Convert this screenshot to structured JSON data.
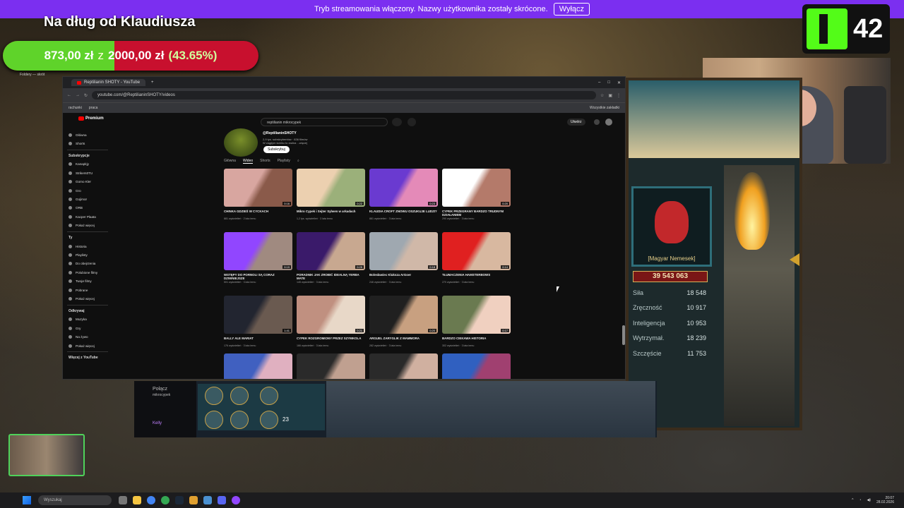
{
  "banner": {
    "text": "Tryb streamowania włączony. Nazwy użytkownika zostały skrócone.",
    "button": "Wyłącz"
  },
  "goal": {
    "title": "Na dług od Klaudiusza",
    "current": "873,00 zł",
    "sep": "z",
    "target": "2000,00 zł",
    "percent_text": "(43.65%)",
    "fraction": 0.4365,
    "fill_color": "#5fd32a",
    "bar_color": "#c8102e"
  },
  "kick": {
    "count": "42",
    "brand_color": "#53fc18"
  },
  "folder_label": "Foldery — skrót",
  "browser": {
    "tab_title": "Reptilianin SHOTY - YouTube",
    "url": "youtube.com/@ReptilianinSHOTY/videos",
    "bookmarks": [
      "rachunki",
      "praca"
    ],
    "bookmarks_right": "Wszystkie zakładki"
  },
  "youtube": {
    "logo": "Premium",
    "search_value": "reptilianin mikrocypek",
    "create": "Utwórz",
    "channel_name": "@ReptilianinSHOTY",
    "channel_meta": "2,9 tys. subskrybentów · 836 filmów",
    "channel_desc": "W ciągłym ścieku to żadna ...więcej",
    "subscribe": "Subskrybuj",
    "tabs": [
      "Główna",
      "Wideo",
      "Shorts",
      "Playlisty"
    ],
    "sidebar": [
      {
        "type": "item",
        "label": "Główna"
      },
      {
        "type": "item",
        "label": "Shorts"
      },
      {
        "type": "sep"
      },
      {
        "type": "head",
        "label": "Subskrypcje"
      },
      {
        "type": "item",
        "label": "Kanapkjy"
      },
      {
        "type": "item",
        "label": "Strikers0TU"
      },
      {
        "type": "item",
        "label": "Gomo Kler"
      },
      {
        "type": "item",
        "label": "Gro"
      },
      {
        "type": "item",
        "label": "Gojimor"
      },
      {
        "type": "item",
        "label": "ORB"
      },
      {
        "type": "item",
        "label": "Kacper Plaata"
      },
      {
        "type": "item",
        "label": "Pokaż więcej"
      },
      {
        "type": "sep"
      },
      {
        "type": "head",
        "label": "Ty"
      },
      {
        "type": "item",
        "label": "Historia"
      },
      {
        "type": "item",
        "label": "Playlisty"
      },
      {
        "type": "item",
        "label": "Do obejrzenia"
      },
      {
        "type": "item",
        "label": "Polubione filmy"
      },
      {
        "type": "item",
        "label": "Twoje filmy"
      },
      {
        "type": "item",
        "label": "Pobrane"
      },
      {
        "type": "item",
        "label": "Pokaż więcej"
      },
      {
        "type": "sep"
      },
      {
        "type": "head",
        "label": "Odkrywaj"
      },
      {
        "type": "item",
        "label": "Muzyka"
      },
      {
        "type": "item",
        "label": "Gry"
      },
      {
        "type": "item",
        "label": "Na żywo"
      },
      {
        "type": "item",
        "label": "Pokaż więcej"
      },
      {
        "type": "sep"
      },
      {
        "type": "head",
        "label": "Więcej z YouTube"
      }
    ],
    "videos": [
      {
        "title": "CHINKA GDZIEŚ W CYCKACH",
        "meta": "881 wyświetleń · 2 lata temu",
        "dur": "0:16",
        "c1": "#d8a6a0",
        "c2": "#8a5a4a"
      },
      {
        "title": "Mikro Cypek i Sejter Sylwen w arkadach",
        "meta": "1,2 tys. wyświetleń · 3 lata temu",
        "dur": "0:22",
        "c1": "#ecd0b0",
        "c2": "#9bb07a"
      },
      {
        "title": "KLAUDIA CROFT ZNOWU OSZUKUJE LUDZI?",
        "meta": "881 wyświetleń · 3 lata temu",
        "dur": "0:23",
        "c1": "#6a3ad0",
        "c2": "#e48ab8"
      },
      {
        "title": "CYPEK PRZEGRANY BARDZO TRUDNYM DZIAŁANIEM",
        "meta": "290 wyświetleń · 3 lata temu",
        "dur": "0:20",
        "c1": "#ffffff",
        "c2": "#b47a6a"
      },
      {
        "title": "WSTĘPY DO PORNOLI SĄ CORAZ DZIWNIEJSZE",
        "meta": "501 wyświetleń · 3 lata temu",
        "dur": "0:19",
        "c1": "#9146ff",
        "c2": "#a08a80"
      },
      {
        "title": "PORADNIK JAK ZROBIĆ IDEALNĄ YERBA MATE",
        "meta": "145 wyświetleń · 3 lata temu",
        "dur": "0:25",
        "c1": "#3a1a6a",
        "c2": "#c8a890"
      },
      {
        "title": "Bolesławiec Kluksza ArGoer",
        "meta": "246 wyświetleń · 3 lata temu",
        "dur": "0:18",
        "c1": "#9fa8b0",
        "c2": "#d0b8a8"
      },
      {
        "title": "TŁUMACZENIA HAMSTERBOWS",
        "meta": "270 wyświetleń · 3 lata temu",
        "dur": "0:14",
        "c1": "#e02020",
        "c2": "#d8b8a0"
      },
      {
        "title": "BALLY ALE MARIAT",
        "meta": "176 wyświetleń · 3 lata temu",
        "dur": "1:41",
        "c1": "#222530",
        "c2": "#6a5a50"
      },
      {
        "title": "CYPEK ROZGROMIONY PRZEZ SZYMKOLA",
        "meta": "166 wyświetleń · 3 lata temu",
        "dur": "0:21",
        "c1": "#c09080",
        "c2": "#e8d8c8"
      },
      {
        "title": "ARGUEL ZARYGLIK Z MAMMORA",
        "meta": "282 wyświetleń · 3 lata temu",
        "dur": "0:20",
        "c1": "#202020",
        "c2": "#c8a080"
      },
      {
        "title": "BARDZO CIEKAWA HISTORIA",
        "meta": "302 wyświetleń · 3 lata temu",
        "dur": "0:17",
        "c1": "#6a7a50",
        "c2": "#f0d0c0"
      },
      {
        "title": "",
        "meta": "",
        "dur": "",
        "c1": "#4060c0",
        "c2": "#e0b0c0"
      },
      {
        "title": "",
        "meta": "",
        "dur": "",
        "c1": "#2a2a2a",
        "c2": "#c0a090"
      },
      {
        "title": "",
        "meta": "",
        "dur": "",
        "c1": "#2a2a2a",
        "c2": "#d0b0a0"
      },
      {
        "title": "",
        "meta": "",
        "dur": "",
        "c1": "#3060c0",
        "c2": "#a04070"
      }
    ]
  },
  "game": {
    "portrait_name": "[Magyar Nemesek]",
    "gold": "39 543 063",
    "stats": [
      {
        "label": "Siła",
        "value": "18 548"
      },
      {
        "label": "Zręczność",
        "value": "10 917"
      },
      {
        "label": "Inteligencja",
        "value": "10 953"
      },
      {
        "label": "Wytrzymał.",
        "value": "18 239"
      },
      {
        "label": "Szczęście",
        "value": "11 753"
      }
    ],
    "strip_left": "Połącz",
    "strip_sub": "mikrocypek",
    "strip_name": "Kelly",
    "counter": "23"
  },
  "taskbar": {
    "search": "Wyszukaj",
    "time": "20:07",
    "date": "28.02.2026"
  }
}
